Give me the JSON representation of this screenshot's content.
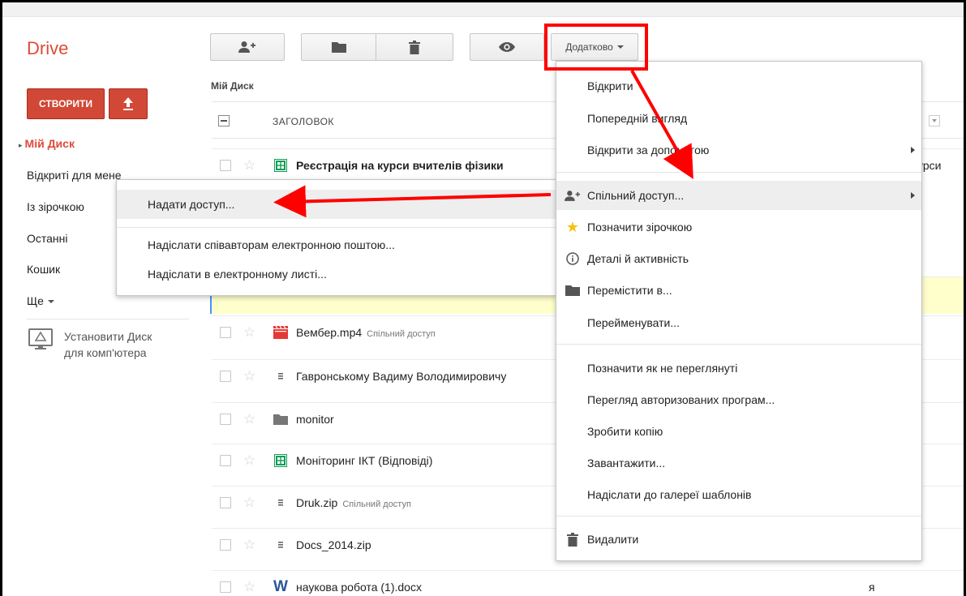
{
  "app": {
    "logo": "Drive"
  },
  "toolbar": {
    "share_icon": "add-person-icon",
    "folder_icon": "folder-icon",
    "delete_icon": "trash-icon",
    "preview_icon": "eye-icon",
    "more_label": "Додатково"
  },
  "sidebar": {
    "create_label": "СТВОРИТИ",
    "upload_icon": "upload-icon",
    "items": [
      {
        "label": "Мій Диск",
        "active": true
      },
      {
        "label": "Відкриті для мене"
      },
      {
        "label": "Із зірочкою"
      },
      {
        "label": "Останні"
      },
      {
        "label": "Кошик"
      },
      {
        "label": "Ще"
      }
    ],
    "install_line1": "Установити Диск",
    "install_line2": "для комп'ютера"
  },
  "main": {
    "breadcrumb": "Мій Диск",
    "column_title": "ЗАГОЛОВОК",
    "files": [
      {
        "name": "Реєстрація на курси вчителів фізики",
        "icon": "spreadsheet-icon",
        "bold": true,
        "right": "урси"
      },
      {
        "name": "",
        "icon": ""
      },
      {
        "name": "",
        "icon": ""
      },
      {
        "name": "",
        "icon": "spreadsheet-icon",
        "selected": true
      },
      {
        "name": "Вембер.mp4",
        "icon": "video-icon",
        "shared": "Спільний доступ"
      },
      {
        "name": "Гавронському Вадиму Володимировичу",
        "icon": "zip-icon"
      },
      {
        "name": "monitor",
        "icon": "folder-icon"
      },
      {
        "name": "Моніторинг ІКТ (Відповіді)",
        "icon": "spreadsheet-icon"
      },
      {
        "name": "Druk.zip",
        "icon": "zip-icon",
        "shared": "Спільний доступ"
      },
      {
        "name": "Docs_2014.zip",
        "icon": "zip-icon"
      },
      {
        "name": "наукова робота (1).docx",
        "icon": "word-icon",
        "right": "я"
      }
    ]
  },
  "more_menu": {
    "items": [
      {
        "label": "Відкрити"
      },
      {
        "label": "Попередній вигляд"
      },
      {
        "label": "Відкрити за допомогою",
        "submenu": true
      },
      {
        "label": "Спільний доступ...",
        "submenu": true,
        "icon": "add-person-icon",
        "hover": true
      },
      {
        "label": "Позначити зірочкою",
        "icon": "star-icon"
      },
      {
        "label": "Деталі й активність",
        "icon": "info-icon"
      },
      {
        "label": "Перемістити в...",
        "icon": "folder-icon"
      },
      {
        "label": "Перейменувати..."
      },
      {
        "label": "Позначити як не переглянуті"
      },
      {
        "label": "Перегляд авторизованих програм..."
      },
      {
        "label": "Зробити копію"
      },
      {
        "label": "Завантажити..."
      },
      {
        "label": "Надіслати до галереї шаблонів"
      },
      {
        "label": "Видалити",
        "icon": "trash-icon"
      }
    ]
  },
  "share_submenu": {
    "items": [
      {
        "label": "Надати доступ..."
      },
      {
        "label": "Надіслати співавторам електронною поштою..."
      },
      {
        "label": "Надіслати в електронному листі..."
      }
    ]
  },
  "colors": {
    "accent_red": "#dd4b39",
    "annotation_red": "#ff0000",
    "sheets_green": "#0f9d58",
    "word_blue": "#2a5699"
  }
}
